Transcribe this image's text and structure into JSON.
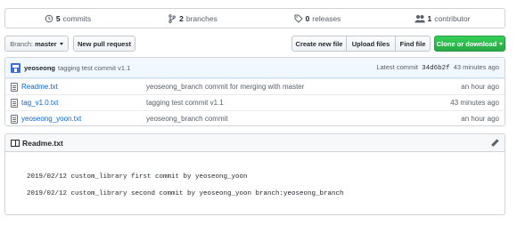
{
  "summary": {
    "commits": {
      "count": "5",
      "label": "commits"
    },
    "branches": {
      "count": "2",
      "label": "branches"
    },
    "releases": {
      "count": "0",
      "label": "releases"
    },
    "contributors": {
      "count": "1",
      "label": "contributor"
    }
  },
  "toolbar": {
    "branch_prefix": "Branch:",
    "branch_name": "master",
    "new_pr": "New pull request",
    "create_file": "Create new file",
    "upload_files": "Upload files",
    "find_file": "Find file",
    "clone": "Clone or download"
  },
  "latest_commit": {
    "author": "yeoseong",
    "message": "tagging test commit v1.1",
    "prefix": "Latest commit",
    "sha": "34d6b2f",
    "age": "43 minutes ago"
  },
  "files": [
    {
      "name": "Readme.txt",
      "message": "yeoseong_branch commit for merging with master",
      "age": "an hour ago"
    },
    {
      "name": "tag_v1.0.txt",
      "message": "tagging test commit v1.1",
      "age": "43 minutes ago"
    },
    {
      "name": "yeoseong_yoon.txt",
      "message": "yeoseong_branch commit",
      "age": "an hour ago"
    }
  ],
  "readme": {
    "title": "Readme.txt",
    "lines": [
      "2019/02/12 custom_library first commit by yeoseong_yoon",
      "2019/02/12 custom_library second commit by yeoseong_yoon branch:yeoseong_branch"
    ]
  },
  "colors": {
    "accent": "#0366d6",
    "clone_green": "#28a745"
  }
}
